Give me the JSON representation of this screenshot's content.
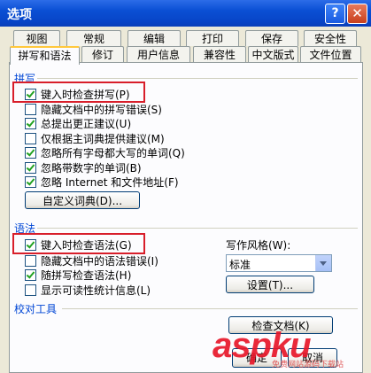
{
  "window": {
    "title": "选项",
    "help_glyph": "?",
    "close_glyph": "✕"
  },
  "tabs_row1": [
    "视图",
    "常规",
    "编辑",
    "打印",
    "保存",
    "安全性"
  ],
  "tabs_row2": [
    "拼写和语法",
    "修订",
    "用户信息",
    "兼容性",
    "中文版式",
    "文件位置"
  ],
  "active_tab": "拼写和语法",
  "spelling": {
    "label": "拼写",
    "options": [
      {
        "label": "键入时检查拼写(P)",
        "checked": true
      },
      {
        "label": "隐藏文档中的拼写错误(S)",
        "checked": false
      },
      {
        "label": "总提出更正建议(U)",
        "checked": true
      },
      {
        "label": "仅根据主词典提供建议(M)",
        "checked": false
      },
      {
        "label": "忽略所有字母都大写的单词(Q)",
        "checked": true
      },
      {
        "label": "忽略带数字的单词(B)",
        "checked": true
      },
      {
        "label": "忽略 Internet 和文件地址(F)",
        "checked": true
      }
    ],
    "custom_dict_button": "自定义词典(D)..."
  },
  "grammar": {
    "label": "语法",
    "options": [
      {
        "label": "键入时检查语法(G)",
        "checked": true
      },
      {
        "label": "隐藏文档中的语法错误(I)",
        "checked": false
      },
      {
        "label": "随拼写检查语法(H)",
        "checked": true
      },
      {
        "label": "显示可读性统计信息(L)",
        "checked": false
      }
    ],
    "writing_style_label": "写作风格(W):",
    "writing_style_value": "标准",
    "settings_button": "设置(T)..."
  },
  "proofing": {
    "label": "校对工具",
    "recheck_button": "检查文档(K)"
  },
  "footer": {
    "ok_button": "确定",
    "cancel_button": "取消"
  },
  "watermark": {
    "text": "aspku",
    "sub": "免费网站源码下载站"
  },
  "colors": {
    "titlebar": "#0A4FD4",
    "highlight": "#D81E2A",
    "group_label": "#0046D5"
  }
}
